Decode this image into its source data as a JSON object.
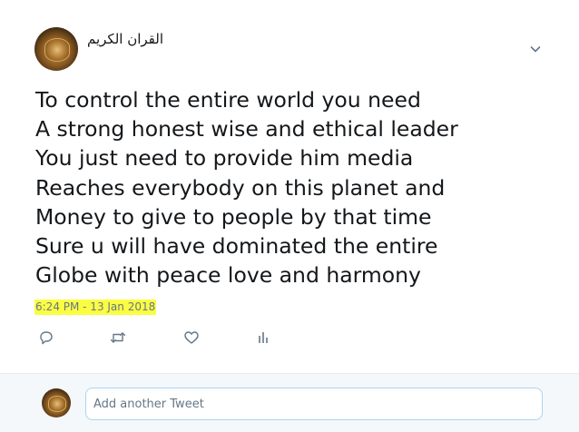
{
  "author": {
    "name": "القران الكريم"
  },
  "tweet": {
    "lines": [
      "To control the entire world you need",
      "A strong honest wise and ethical leader",
      "You just need to provide him media",
      "Reaches everybody on this planet and",
      "Money to give to people by that time",
      "Sure u will have dominated the entire",
      "Globe with peace love and harmony"
    ],
    "timestamp": "6:24 PM - 13 Jan 2018"
  },
  "actions": {
    "icons": [
      "reply-icon",
      "retweet-icon",
      "like-icon",
      "analytics-icon"
    ]
  },
  "compose": {
    "placeholder": "Add another Tweet"
  },
  "colors": {
    "text": "#14171a",
    "muted": "#657786",
    "highlight": "#fbfd43",
    "footer_bg": "#f5f8fa",
    "input_border": "#a9d4f2"
  }
}
